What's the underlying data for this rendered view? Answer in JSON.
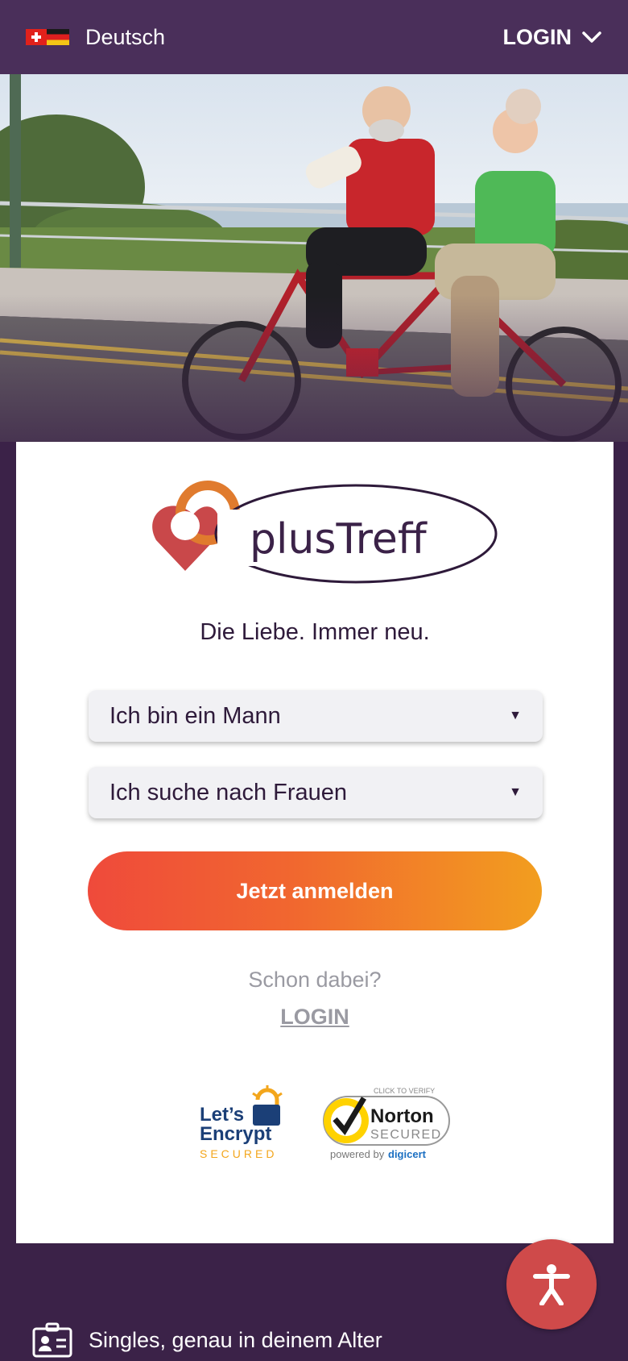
{
  "header": {
    "language_label": "Deutsch",
    "login_label": "LOGIN"
  },
  "hero": {
    "image_description_icon": "tandem-bike-couple-photo"
  },
  "brand": {
    "logo_text": "plusTreff",
    "tagline": "Die Liebe. Immer neu."
  },
  "form": {
    "gender_select": {
      "selected": "Ich bin ein Mann"
    },
    "seeking_select": {
      "selected": "Ich suche nach Frauen"
    },
    "submit_label": "Jetzt anmelden"
  },
  "existing": {
    "prompt": "Schon dabei?",
    "login_link": "LOGIN"
  },
  "badges": {
    "letsencrypt": {
      "line1": "Let’s",
      "line2": "Encrypt",
      "line3": "SECURED"
    },
    "norton": {
      "click": "CLICK TO VERIFY",
      "name": "Norton",
      "secured": "SECURED",
      "powered": "powered by",
      "brand": "digicert"
    }
  },
  "footer": {
    "feature_text": "Singles, genau in deinem Alter"
  },
  "colors": {
    "background": "#3b2248",
    "topbar": "#4a2f5a",
    "cta_start": "#ef4a3b",
    "cta_end": "#f29e1f",
    "accessibility": "#cf4a4a"
  }
}
